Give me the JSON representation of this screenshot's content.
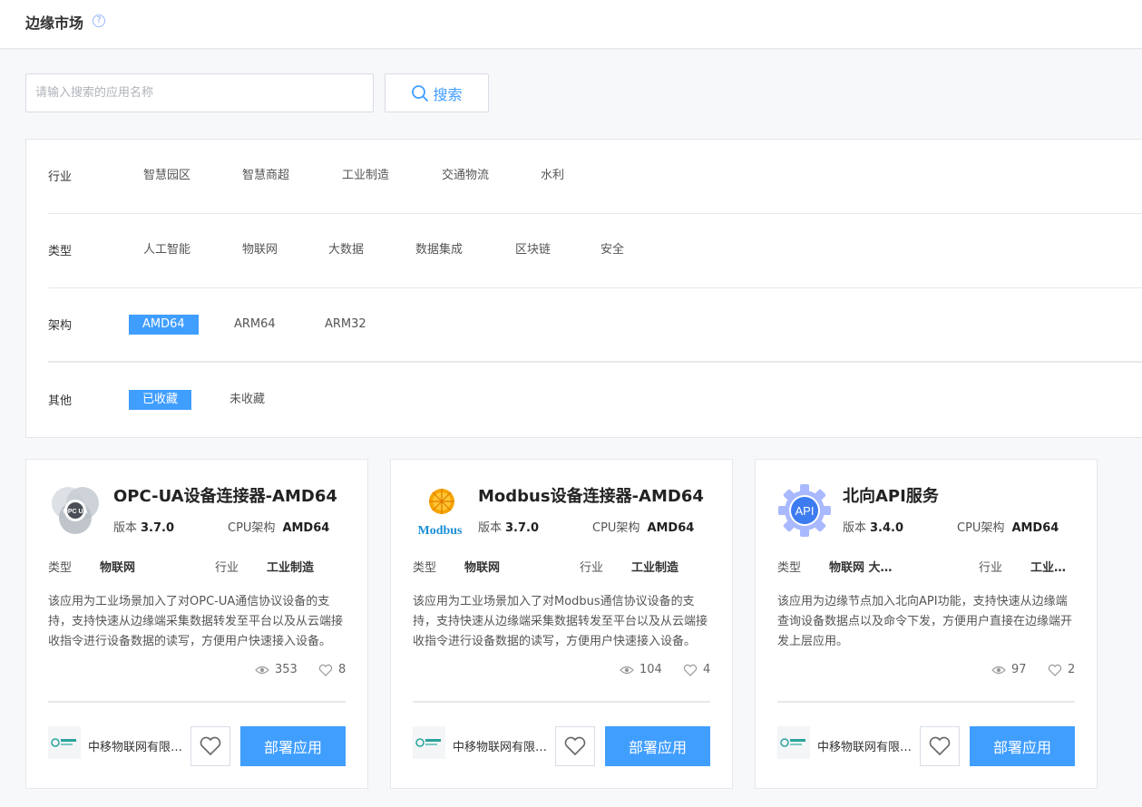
{
  "header": {
    "title": "边缘市场",
    "help_icon": "?"
  },
  "search": {
    "placeholder": "请输入搜索的应用名称",
    "value": "",
    "button_label": "搜索"
  },
  "filters": {
    "industry": {
      "label": "行业",
      "options": [
        "智慧园区",
        "智慧商超",
        "工业制造",
        "交通物流",
        "水利"
      ]
    },
    "type": {
      "label": "类型",
      "options": [
        "人工智能",
        "物联网",
        "大数据",
        "数据集成",
        "区块链",
        "安全"
      ]
    },
    "arch": {
      "label": "架构",
      "options": [
        "AMD64",
        "ARM64",
        "ARM32"
      ],
      "selected": "AMD64"
    },
    "other": {
      "label": "其他",
      "options": [
        "已收藏",
        "未收藏"
      ],
      "selected": "已收藏"
    }
  },
  "cards": [
    {
      "logo": "opc-ua-logo",
      "logo_text": "OPC UA",
      "title": "OPC-UA设备连接器-AMD64",
      "version_label": "版本",
      "version": "3.7.0",
      "cpu_label": "CPU架构",
      "cpu": "AMD64",
      "type_label": "类型",
      "type": "物联网",
      "industry_label": "行业",
      "industry": "工业制造",
      "description": "该应用为工业场景加入了对OPC-UA通信协议设备的支持，支持快速从边缘端采集数据转发至平台以及从云端接收指令进行设备数据的读写，方便用户快速接入设备。",
      "views": "353",
      "likes": "8",
      "vendor": "中移物联网有限公司",
      "deploy_label": "部署应用"
    },
    {
      "logo": "modbus-logo",
      "logo_text": "Modbus",
      "title": "Modbus设备连接器-AMD64",
      "version_label": "版本",
      "version": "3.7.0",
      "cpu_label": "CPU架构",
      "cpu": "AMD64",
      "type_label": "类型",
      "type": "物联网",
      "industry_label": "行业",
      "industry": "工业制造",
      "description": "该应用为工业场景加入了对Modbus通信协议设备的支持，支持快速从边缘端采集数据转发至平台以及从云端接收指令进行设备数据的读写，方便用户快速接入设备。",
      "views": "104",
      "likes": "4",
      "vendor": "中移物联网有限公司",
      "deploy_label": "部署应用"
    },
    {
      "logo": "api-gear-logo",
      "logo_text": "API",
      "title": "北向API服务",
      "version_label": "版本",
      "version": "3.4.0",
      "cpu_label": "CPU架构",
      "cpu": "AMD64",
      "type_label": "类型",
      "type": "物联网 大数据",
      "industry_label": "行业",
      "industry": "工业制造",
      "description": "该应用为边缘节点加入北向API功能，支持快速从边缘端查询设备数据点以及命令下发，方便用户直接在边缘端开发上层应用。",
      "views": "97",
      "likes": "2",
      "vendor": "中移物联网有限公司",
      "deploy_label": "部署应用"
    }
  ],
  "colors": {
    "primary": "#409eff",
    "background": "#f7f8fa"
  }
}
